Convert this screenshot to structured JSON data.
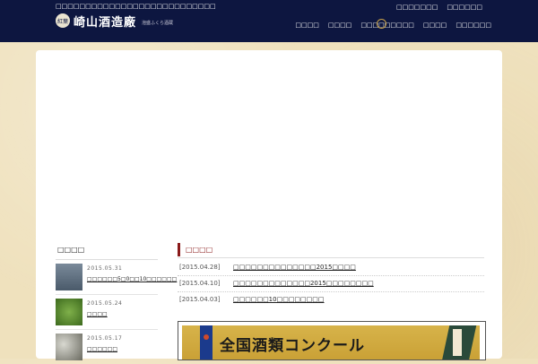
{
  "header": {
    "tagline": "□□□□□□□□□□□□□□□□□□□□□□□□□□□",
    "logo_seal": "紅葉",
    "logo_name": "崎山酒造廠",
    "logo_sub": "泡盛ふくら酒蔵",
    "util_links": [
      "□□□□□□□",
      "□□□□□□"
    ],
    "nav": [
      "□□□□",
      "□□□□",
      "□□□□□□□□□",
      "□□□□",
      "□□□□□□"
    ]
  },
  "sidebar": {
    "title": "□□□□",
    "posts": [
      {
        "date": "2015.05.31",
        "title": "□□□□□□5□0□□10□□□□□□"
      },
      {
        "date": "2015.05.24",
        "title": "□□□□"
      },
      {
        "date": "2015.05.17",
        "title": "□□□□□□"
      }
    ]
  },
  "news": {
    "heading": "□□□□",
    "items": [
      {
        "date": "[2015.04.28]",
        "title": "□□□□□□□□□□□□□□2015□□□□"
      },
      {
        "date": "[2015.04.10]",
        "title": "□□□□□□□□□□□□□2015□□□□□□□□"
      },
      {
        "date": "[2015.04.03]",
        "title": "□□□□□□10□□□□□□□□"
      }
    ]
  },
  "banner": {
    "text": "全国酒類コンクール"
  },
  "colors": {
    "header_bg": "#0d1640",
    "accent_red": "#8a1a1a",
    "page_bg": "#efe1bd"
  }
}
